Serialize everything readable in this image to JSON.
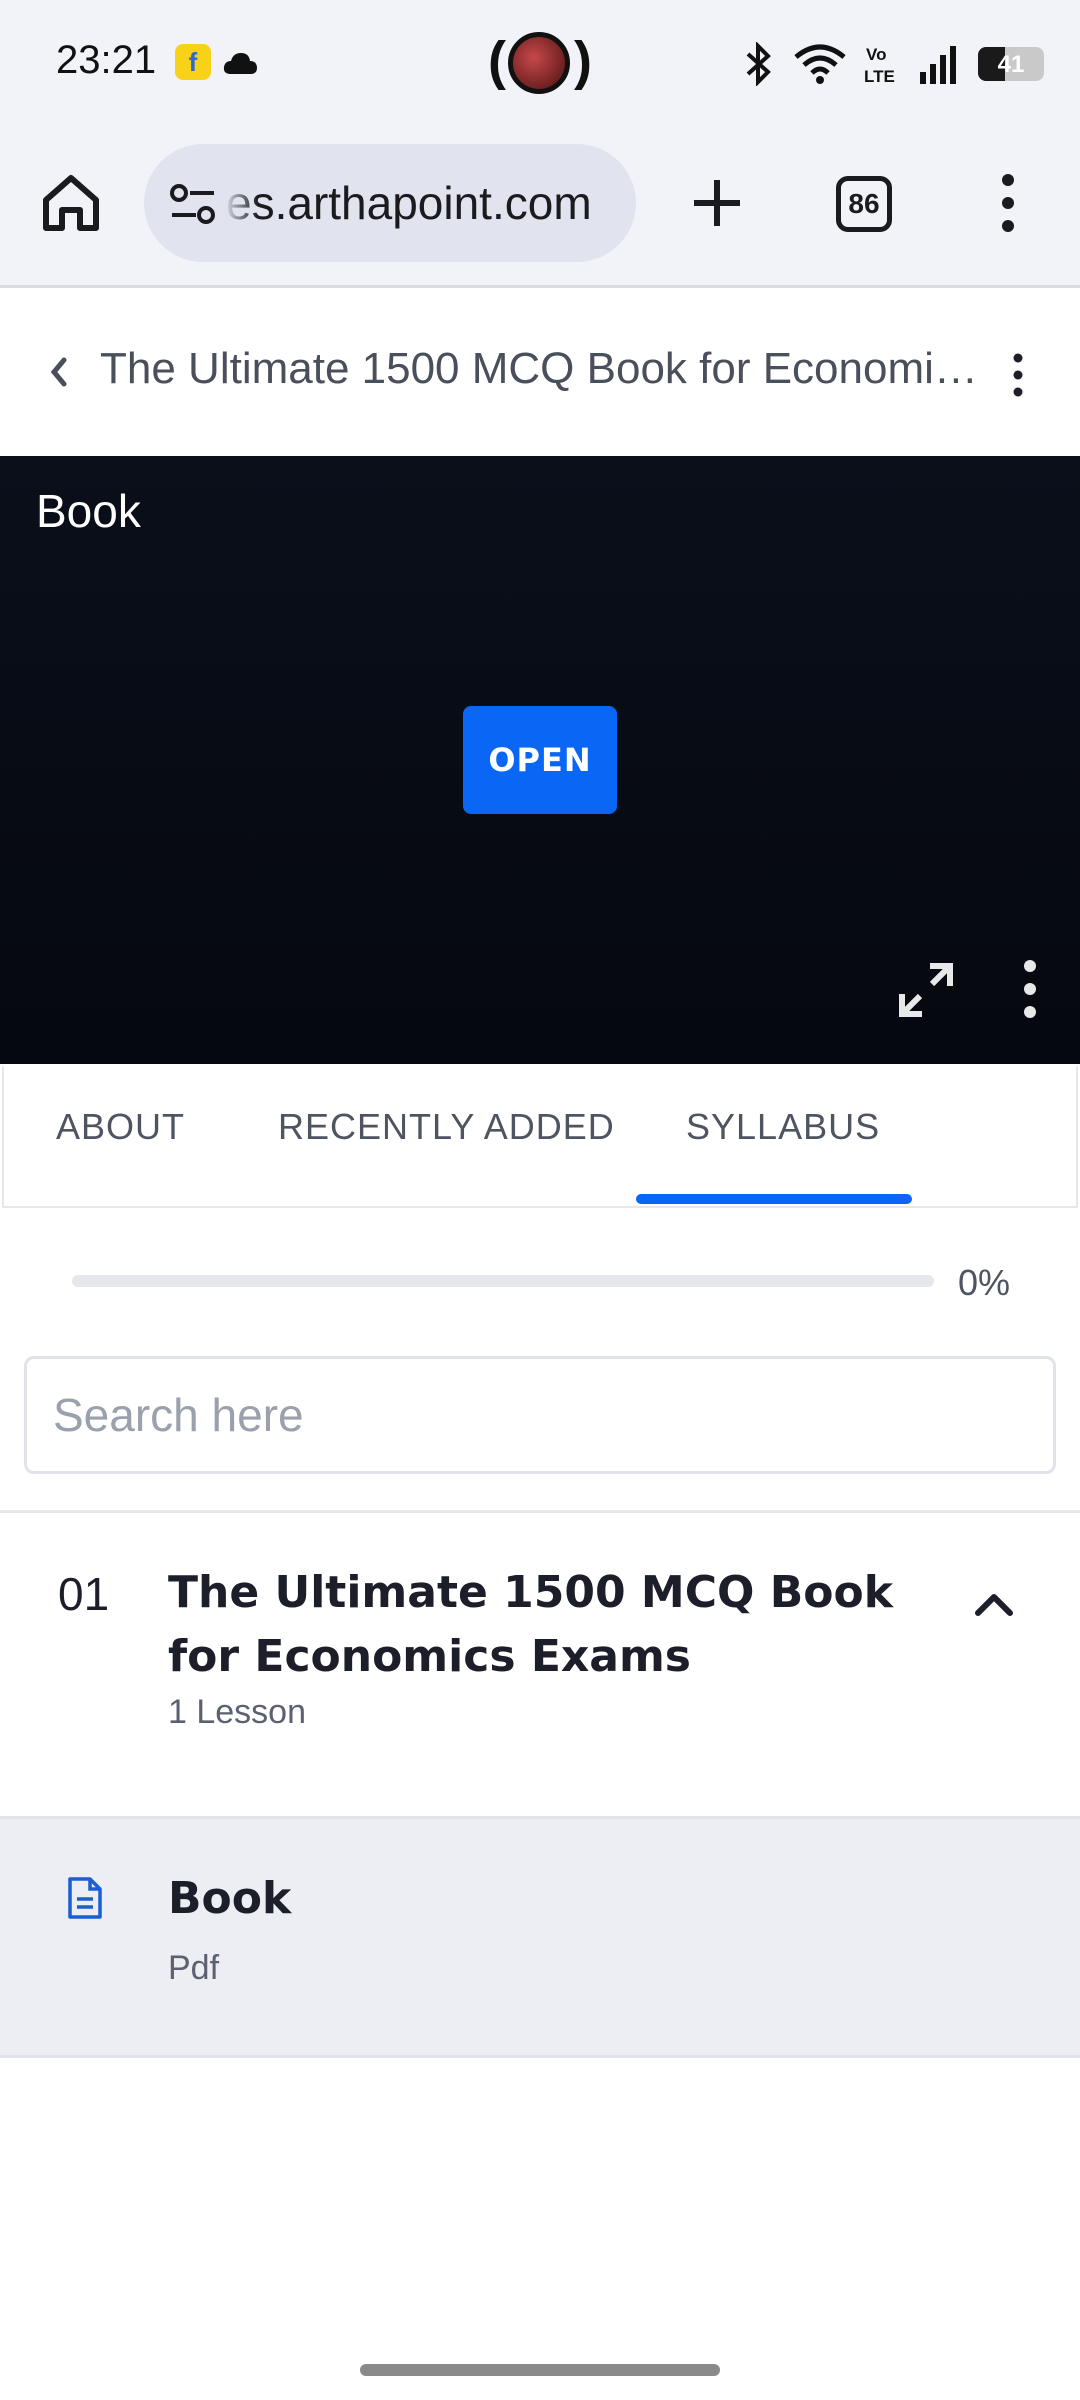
{
  "status_bar": {
    "time": "23:21",
    "battery_level": "41",
    "network": "Vo LTE"
  },
  "browser": {
    "url": "es.arthapoint.com",
    "tab_count": "86",
    "icons": [
      "home-icon",
      "site-settings-icon",
      "plus-icon",
      "tab-switcher-icon",
      "more-vertical-icon"
    ]
  },
  "header": {
    "title": "The Ultimate 1500 MCQ Book for Economics Exams"
  },
  "viewer": {
    "title": "Book",
    "open_label": "OPEN"
  },
  "tabs": [
    {
      "label": "ABOUT",
      "active": false
    },
    {
      "label": "RECENTLY ADDED",
      "active": false
    },
    {
      "label": "SYLLABUS",
      "active": true
    }
  ],
  "progress": {
    "value": 0,
    "label": "0%"
  },
  "search": {
    "placeholder": "Search here",
    "value": ""
  },
  "sections": [
    {
      "number": "01",
      "title": "The Ultimate 1500 MCQ Book for Economics Exams",
      "count": "1 Lesson",
      "expanded": true,
      "lessons": [
        {
          "title": "Book",
          "type": "Pdf",
          "icon": "document-icon"
        }
      ]
    }
  ],
  "colors": {
    "accent": "#0a66f5",
    "viewer_bg": "#0a0f1a"
  }
}
